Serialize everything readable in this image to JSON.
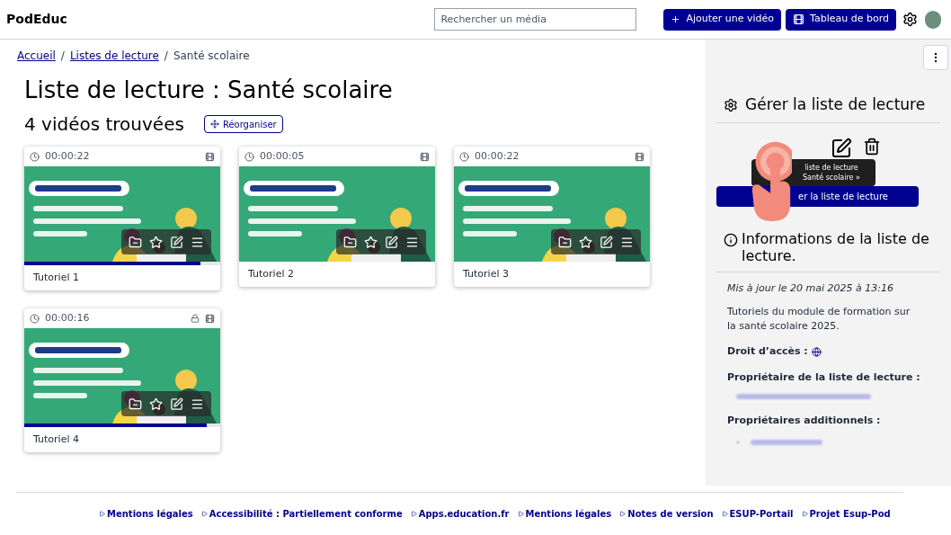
{
  "header": {
    "brand": "PodEduc",
    "search": {
      "placeholder": "Rechercher un média"
    },
    "buttons": [
      {
        "label": "Ajouter une vidéo",
        "kind": "add"
      },
      {
        "label": "Tableau de bord",
        "kind": "dashboard"
      }
    ]
  },
  "breadcrumb_separator": "/",
  "breadcrumb": [
    {
      "label": "Accueil",
      "link": true
    },
    {
      "label": "Listes de lecture",
      "link": true
    },
    {
      "label": "Santé scolaire",
      "link": false
    }
  ],
  "title": "Liste de lecture : Santé scolaire",
  "count": "4 vidéos trouvées",
  "reorder_button": "Réorganiser",
  "videos": [
    {
      "duration": "00:00:22",
      "title": "Tutoriel 1",
      "locked": false,
      "level": 0.9
    },
    {
      "duration": "00:00:05",
      "title": "Tutoriel 2",
      "locked": false
    },
    {
      "duration": "00:00:22",
      "title": "Tutoriel 3",
      "locked": false
    },
    {
      "duration": "00:00:16",
      "title": "Tutoriel 4",
      "locked": true,
      "level": 0.93
    }
  ],
  "sidebar": {
    "manage_title": "Gérer la liste de lecture",
    "tooltip": [
      "liste de lecture",
      "Santé scolaire »"
    ],
    "primary_button": "er la liste de lecture",
    "info_title": "Informations de la liste de lecture.",
    "updated": "Mis à jour le 20 mai 2025 à 13:16",
    "description": "Tutoriels du module de formation sur la santé scolaire 2025.",
    "access_label": "Droit d’accès :",
    "owner_label": "Propriétaire de la liste de lecture :",
    "additional_owners_label": "Propriétaires additionnels :"
  },
  "footer": {
    "links": [
      "Mentions légales",
      "Accessibilité : Partiellement conforme",
      "Apps.education.fr",
      "Mentions légales",
      "Notes de version",
      "ESUP-Portail",
      "Projet Esup-Pod"
    ]
  }
}
